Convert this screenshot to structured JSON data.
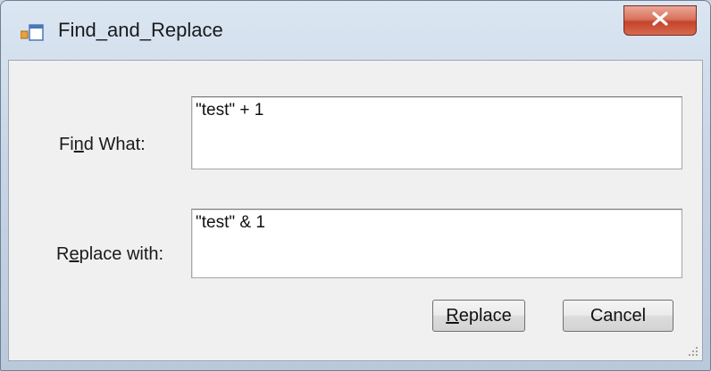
{
  "window": {
    "title": "Find_and_Replace",
    "close_glyph": "✕"
  },
  "find": {
    "label_before": "Fi",
    "label_accel": "n",
    "label_after": "d What:",
    "value": "\"test\" + 1"
  },
  "replace": {
    "label_before": "R",
    "label_accel": "e",
    "label_after": "place with:",
    "value": "\"test\" & 1"
  },
  "buttons": {
    "replace_accel": "R",
    "replace_rest": "eplace",
    "cancel": "Cancel"
  },
  "colors": {
    "close_button": "#c4442c",
    "client_bg": "#f0f0f0",
    "frame": "#c8d6e6"
  },
  "icons": {
    "app": "form-window-icon",
    "close": "close-icon",
    "grip": "size-grip-icon"
  }
}
